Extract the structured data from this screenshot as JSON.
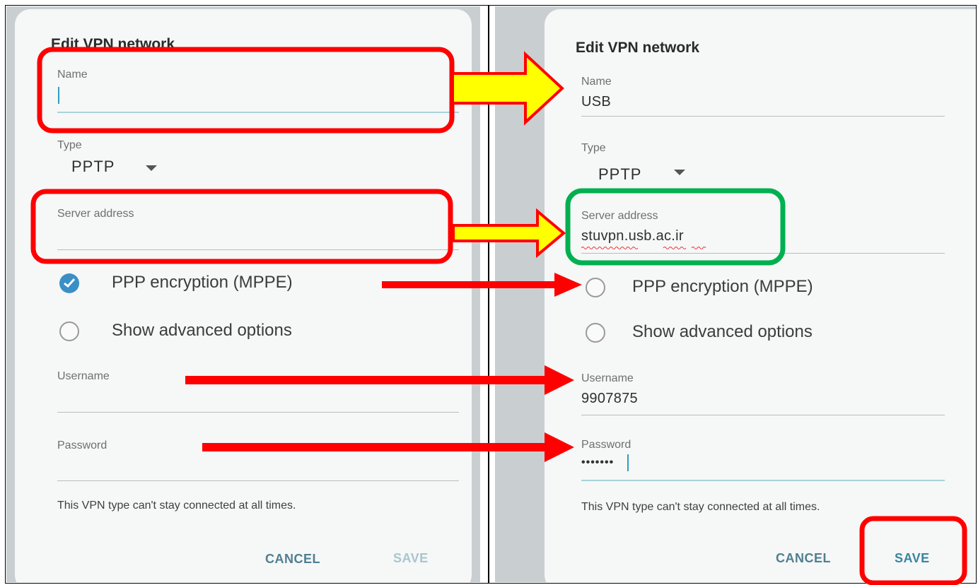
{
  "dialog_title": "Edit VPN network",
  "before": {
    "name_label": "Name",
    "name_value": "",
    "type_label": "Type",
    "type_value": "PPTP",
    "server_label": "Server address",
    "server_value": "",
    "ppp_label": "PPP encryption (MPPE)",
    "ppp_checked": true,
    "advanced_label": "Show advanced options",
    "advanced_checked": false,
    "username_label": "Username",
    "username_value": "",
    "password_label": "Password",
    "password_value": "",
    "note": "This VPN type can't stay connected at all times.",
    "cancel_label": "CANCEL",
    "save_label": "SAVE",
    "save_enabled": false
  },
  "after": {
    "name_label": "Name",
    "name_value": "USB",
    "type_label": "Type",
    "type_value": "PPTP",
    "server_label": "Server address",
    "server_value": "stuvpn.usb.ac.ir",
    "ppp_label": "PPP encryption (MPPE)",
    "ppp_checked": false,
    "advanced_label": "Show advanced options",
    "advanced_checked": false,
    "username_label": "Username",
    "username_value": "9907875",
    "password_label": "Password",
    "password_value": "•••••••",
    "note": "This VPN type can't stay connected at all times.",
    "cancel_label": "CANCEL",
    "save_label": "SAVE",
    "save_enabled": true
  },
  "annotation_colors": {
    "highlight_red": "#ff0000",
    "highlight_green": "#00b050",
    "arrow_fill": "#ffff00",
    "arrow_red": "#ff0000"
  }
}
